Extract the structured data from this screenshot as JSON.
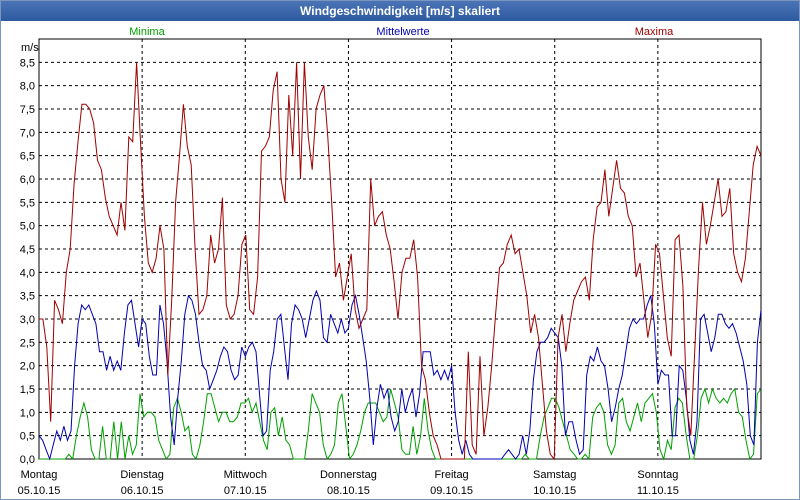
{
  "window": {
    "title": "Windgeschwindigkeit [m/s] skaliert"
  },
  "chart_data": {
    "type": "line",
    "title": "Windgeschwindigkeit [m/s] skaliert",
    "ylabel": "m/s",
    "ylim": [
      0,
      9
    ],
    "yticks": [
      "0,0",
      "0,5",
      "1,0",
      "1,5",
      "2,0",
      "2,5",
      "3,0",
      "3,5",
      "4,0",
      "4,5",
      "5,0",
      "5,5",
      "6,0",
      "6,5",
      "7,0",
      "7,5",
      "8,0",
      "8,5"
    ],
    "days": [
      {
        "name": "Montag",
        "date": "05.10.15"
      },
      {
        "name": "Dienstag",
        "date": "06.10.15"
      },
      {
        "name": "Mittwoch",
        "date": "07.10.15"
      },
      {
        "name": "Donnerstag",
        "date": "08.10.15"
      },
      {
        "name": "Freitag",
        "date": "09.10.15"
      },
      {
        "name": "Samstag",
        "date": "10.10.15"
      },
      {
        "name": "Sonntag",
        "date": "11.10.15"
      }
    ],
    "grid": true,
    "series": [
      {
        "name": "Minima",
        "color": "#00a000",
        "values": [
          0,
          0,
          0,
          0,
          0,
          0,
          0,
          0,
          0.1,
          0,
          0.5,
          0.9,
          1.2,
          0.9,
          0.2,
          0,
          0,
          0.7,
          0,
          0,
          0.8,
          0,
          0.8,
          0,
          0.5,
          0.1,
          0.3,
          1.4,
          0.9,
          1.0,
          1.0,
          0.9,
          0.4,
          0.2,
          0,
          0.1,
          1.1,
          1.3,
          1.0,
          0.6,
          0.7,
          0.1,
          0,
          0.3,
          0.8,
          1.4,
          1.4,
          1.1,
          0.8,
          1.0,
          1.0,
          0.8,
          0.8,
          0.9,
          1.2,
          1.2,
          1.3,
          1.0,
          1.2,
          0.8,
          0.4,
          0.2,
          1.0,
          1.1,
          0.5,
          0.9,
          0.4,
          0.3,
          0,
          0,
          0,
          0,
          0.6,
          1.4,
          1.2,
          1.0,
          0.3,
          0,
          0.1,
          0.3,
          1.2,
          1.4,
          0.7,
          0,
          0.1,
          0.3,
          0.6,
          1.0,
          1.2,
          1.2,
          1.2,
          1.0,
          0.8,
          0.9,
          1.5,
          1.2,
          0.9,
          0.2,
          0.1,
          0.1,
          0.7,
          0.1,
          0.5,
          1.3,
          0.6,
          0.2,
          0,
          0,
          0,
          0,
          0,
          0,
          0,
          0,
          0,
          0,
          0,
          0,
          0,
          0,
          0,
          0,
          0,
          0,
          0,
          0,
          0,
          0,
          0,
          0,
          0.1,
          0,
          0,
          0,
          0.5,
          0.9,
          1.1,
          1.3,
          1.3,
          1.1,
          0.8,
          0.5,
          0.2,
          0.1,
          0,
          0,
          0.1,
          0,
          0.9,
          1.1,
          1.2,
          1.0,
          0.3,
          0.1,
          0.3,
          1.2,
          1.3,
          0.8,
          0.6,
          0.9,
          1.2,
          0.8,
          1.2,
          1.3,
          1.4,
          1.0,
          0.2,
          0,
          0.4,
          0.2,
          1.1,
          1.3,
          1.2,
          0.5,
          0,
          0,
          0.5,
          1.3,
          1.5,
          1.2,
          1.5,
          1.3,
          1.2,
          1.3,
          1.2,
          1.4,
          1.5,
          1.0,
          0.9,
          0.4,
          0,
          0.1,
          1.4,
          1.5
        ]
      },
      {
        "name": "Mittelwerte",
        "color": "#0000b0",
        "values": [
          0.5,
          0.4,
          0.2,
          0,
          0.3,
          0.6,
          0.4,
          0.7,
          0.4,
          0.6,
          2.0,
          2.9,
          3.3,
          3.2,
          3.3,
          3.1,
          2.9,
          2.3,
          2.3,
          1.9,
          2.2,
          1.9,
          2.1,
          1.9,
          2.7,
          3.3,
          3.4,
          2.9,
          2.4,
          3.0,
          2.9,
          2.2,
          1.8,
          1.8,
          3.3,
          2.9,
          2.1,
          0.9,
          0.3,
          1.3,
          2.1,
          3.1,
          3.5,
          3.4,
          3.1,
          2.5,
          2.0,
          1.9,
          1.5,
          1.7,
          1.9,
          2.2,
          2.4,
          2.3,
          1.9,
          1.7,
          1.8,
          2.4,
          2.2,
          2.4,
          2.5,
          2.3,
          1.4,
          0.5,
          0.6,
          1.9,
          2.3,
          3.0,
          3.1,
          2.4,
          1.7,
          2.9,
          3.3,
          3.2,
          3.0,
          2.6,
          3.0,
          3.4,
          3.6,
          3.4,
          2.6,
          2.5,
          3.1,
          2.9,
          2.7,
          3.0,
          2.7,
          2.8,
          3.3,
          3.5,
          3.1,
          2.6,
          2.1,
          1.3,
          0.3,
          1.1,
          1.6,
          1.3,
          1.5,
          0.9,
          0.6,
          0.8,
          1.5,
          1.0,
          1.3,
          1.5,
          0.9,
          1.4,
          2.3,
          2.3,
          2.3,
          1.8,
          1.9,
          1.7,
          1.9,
          1.7,
          2.0,
          1.0,
          0.4,
          0.1,
          0.4,
          0.1,
          0,
          0,
          0,
          0,
          0,
          0,
          0,
          0,
          0,
          0.1,
          0.2,
          0.1,
          0,
          0.1,
          0.5,
          0.1,
          0.6,
          1.7,
          2.3,
          2.5,
          2.5,
          2.6,
          2.8,
          2.7,
          2.6,
          2.0,
          0.5,
          0.8,
          0.8,
          0.4,
          0.1,
          0.2,
          1.8,
          2.2,
          2.1,
          2.4,
          2.1,
          2.0,
          1.5,
          0.8,
          1.1,
          1.5,
          1.8,
          2.3,
          2.8,
          3.0,
          2.9,
          3.0,
          3.0,
          3.3,
          3.5,
          2.9,
          1.6,
          1.9,
          1.8,
          1.8,
          0.5,
          0.5,
          2.0,
          1.9,
          1.3,
          0.4,
          0.1,
          0.8,
          3.0,
          3.1,
          2.7,
          2.3,
          2.6,
          3.1,
          3.1,
          2.9,
          2.8,
          2.9,
          2.7,
          2.4,
          2.1,
          1.6,
          0.5,
          0.3,
          2.5,
          3.2
        ]
      },
      {
        "name": "Maxima",
        "color": "#a00000",
        "values": [
          3.0,
          3.0,
          2.4,
          0.8,
          3.4,
          3.2,
          2.9,
          4.0,
          4.5,
          5.9,
          6.8,
          7.6,
          7.6,
          7.5,
          7.2,
          6.4,
          6.2,
          5.6,
          5.2,
          5.0,
          4.8,
          5.5,
          4.9,
          6.9,
          6.8,
          8.5,
          6.8,
          5.2,
          4.2,
          4.0,
          4.3,
          5.0,
          4.5,
          1.8,
          3.4,
          5.5,
          6.5,
          7.6,
          6.7,
          6.3,
          4.5,
          3.1,
          3.2,
          3.5,
          4.8,
          4.2,
          4.5,
          5.6,
          3.3,
          3.0,
          3.1,
          3.5,
          4.6,
          4.8,
          3.2,
          3.1,
          3.9,
          6.6,
          6.7,
          6.9,
          7.9,
          8.3,
          6.0,
          5.5,
          7.8,
          6.5,
          8.5,
          6.0,
          8.5,
          6.9,
          6.2,
          7.5,
          7.8,
          8.0,
          6.9,
          5.5,
          3.9,
          4.2,
          3.4,
          3.9,
          4.4,
          3.2,
          2.8,
          3.0,
          3.2,
          6.0,
          5.0,
          5.2,
          5.3,
          4.8,
          4.5,
          3.8,
          3.0,
          4.0,
          4.3,
          4.3,
          4.7,
          3.9,
          2.0,
          1.7,
          1.0,
          0.5,
          0.3,
          0,
          0,
          0,
          0,
          0,
          0,
          0,
          2.3,
          0.3,
          0.1,
          2.2,
          0.5,
          1.1,
          2.0,
          3.1,
          4.1,
          4.2,
          4.6,
          4.8,
          4.4,
          4.5,
          4.0,
          3.5,
          2.7,
          3.1,
          2.6,
          1.6,
          0.6,
          0.1,
          0,
          2.6,
          3.1,
          2.3,
          2.9,
          3.4,
          3.6,
          3.8,
          3.9,
          3.4,
          4.7,
          5.4,
          5.5,
          6.2,
          5.2,
          5.8,
          6.4,
          5.8,
          5.7,
          5.2,
          5.0,
          3.9,
          4.2,
          3.4,
          2.6,
          3.1,
          4.6,
          4.4,
          3.5,
          2.6,
          2.2,
          4.7,
          4.8,
          3.7,
          1.1,
          0.5,
          2.3,
          4.1,
          5.5,
          4.6,
          5.0,
          5.5,
          6.0,
          5.2,
          5.3,
          5.8,
          4.4,
          4.0,
          3.8,
          4.3,
          5.3,
          6.3,
          6.7,
          6.5
        ]
      }
    ]
  }
}
